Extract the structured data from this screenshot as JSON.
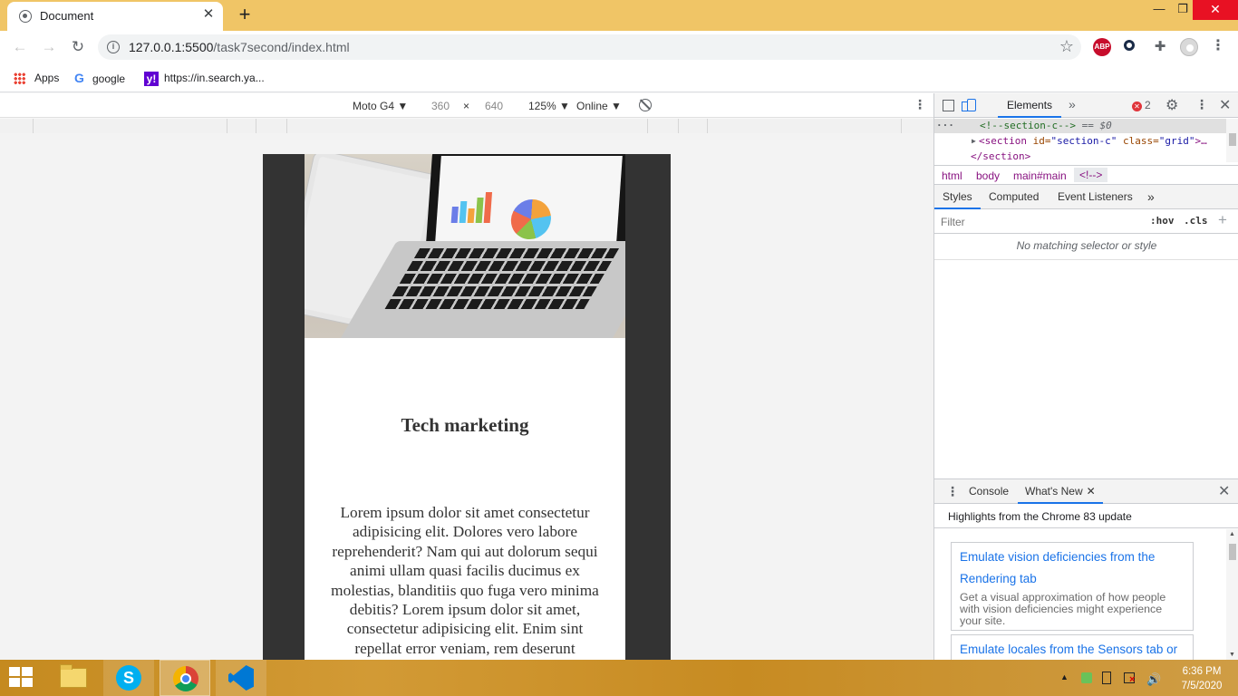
{
  "browser": {
    "tab_title": "Document",
    "new_tab": "+",
    "url_host": "127.0.0.1:5500",
    "url_path": "/task7second/index.html"
  },
  "bookmarks": [
    {
      "label": "Apps"
    },
    {
      "label": "google"
    },
    {
      "label": "https://in.search.ya..."
    }
  ],
  "device_toolbar": {
    "device": "Moto G4 ▼",
    "width": "360",
    "x": "×",
    "height": "640",
    "zoom": "125% ▼",
    "network": "Online ▼"
  },
  "page": {
    "title": "Tech marketing",
    "body": "Lorem ipsum dolor sit amet consectetur adipisicing elit. Dolores vero labore reprehenderit? Nam qui aut dolorum sequi animi ullam quasi facilis ducimus ex molestias, blanditiis quo fuga vero minima debitis? Lorem ipsum dolor sit amet, consectetur adipisicing elit. Enim sint repellat error veniam, rem deserunt"
  },
  "devtools": {
    "tab_elements": "Elements",
    "more_tabs": "»",
    "error_count": "2",
    "dom": {
      "line1_comment": "<!--section-c-->",
      "line1_sel": " == $0",
      "line2_open": "<section",
      "line2_id_attr": " id=",
      "line2_id_val": "\"section-c\"",
      "line2_class_attr": " class=",
      "line2_class_val": "\"grid\"",
      "line2_rest": ">…",
      "line3": "</section>"
    },
    "breadcrumbs": [
      "html",
      "body",
      "main#main",
      "<!-->"
    ],
    "subtabs": [
      "Styles",
      "Computed",
      "Event Listeners",
      "»"
    ],
    "filter_placeholder": "Filter",
    "hov": ":hov",
    "cls": ".cls",
    "no_match": "No matching selector or style",
    "drawer": {
      "console": "Console",
      "whats_new": "What's New",
      "heading": "Highlights from the Chrome 83 update",
      "cards": [
        {
          "title": "Emulate vision deficiencies from the Rendering tab",
          "desc": "Get a visual approximation of how people with vision deficiencies might experience your site."
        },
        {
          "title": "Emulate locales from the Sensors tab or",
          "desc": ""
        }
      ]
    }
  },
  "taskbar": {
    "time": "6:36 PM",
    "date": "7/5/2020"
  }
}
